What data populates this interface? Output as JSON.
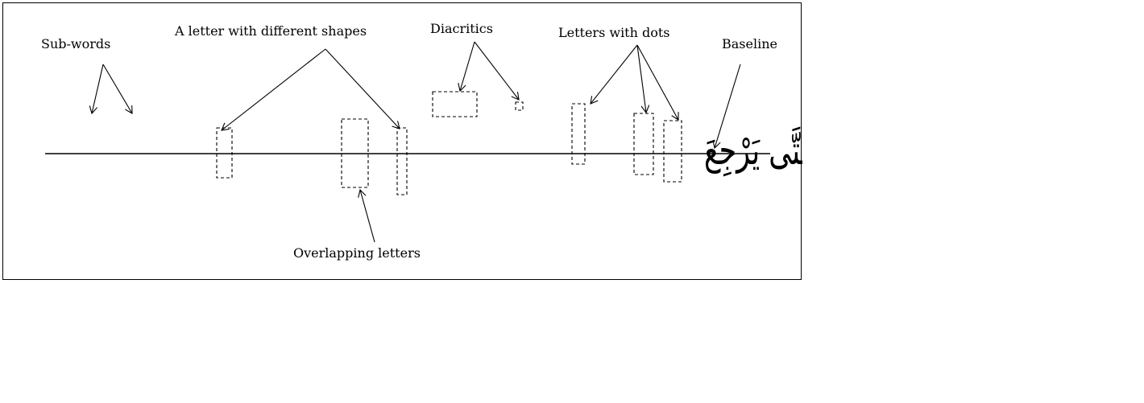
{
  "labels": {
    "sub_words": "Sub-words",
    "letter_shapes": "A letter with different shapes",
    "diacritics": "Diacritics",
    "letters_with_dots": "Letters with dots",
    "baseline": "Baseline",
    "overlapping": "Overlapping letters"
  },
  "arabic_sentence": "مَنْ خَرَجَ فِي طَلَبِ الْعِلْمِ فَهُوَ فِي سَبِيلِ اللَّهِ حَتَّى يَرْجِعَ"
}
